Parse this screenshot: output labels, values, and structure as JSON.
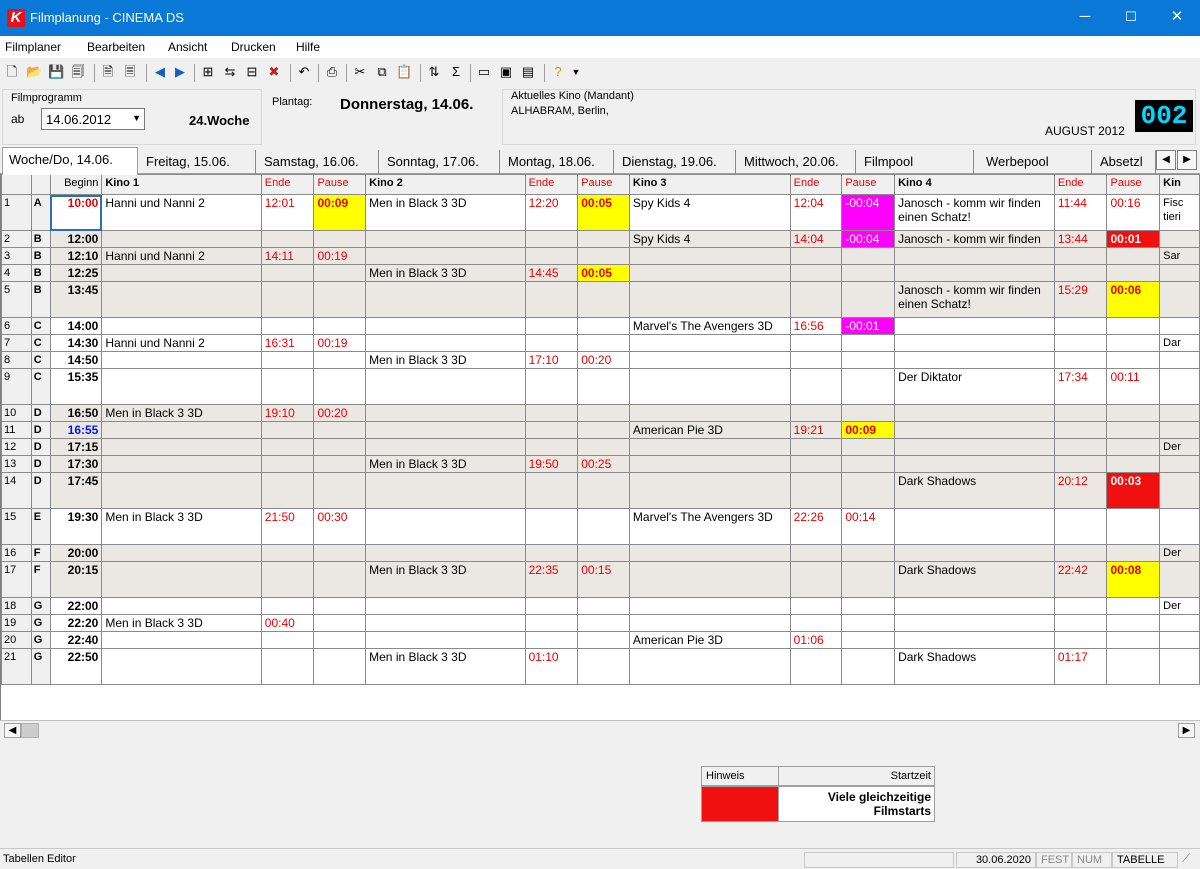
{
  "window": {
    "title": "Filmplanung - CINEMA DS",
    "logo_letter": "K",
    "btn_min": "─",
    "btn_max": "☐",
    "btn_close": "✕"
  },
  "menu": [
    "Filmplaner",
    "Bearbeiten",
    "Ansicht",
    "Drucken",
    "Hilfe"
  ],
  "info": {
    "filmprogramm_label": "Filmprogramm",
    "ab_label": "ab",
    "date_value": "14.06.2012",
    "week": "24.Woche",
    "plantag_label": "Plantag:",
    "plantag_value": "Donnerstag, 14.06.",
    "kino_label": "Aktuelles Kino (Mandant)",
    "kino_value": "ALHABRAM, Berlin,",
    "month": "AUGUST 2012",
    "counter": "002"
  },
  "tabs": [
    "Woche/Do, 14.06.",
    "Freitag, 15.06.",
    "Samstag, 16.06.",
    "Sonntag, 17.06.",
    "Montag, 18.06.",
    "Dienstag, 19.06.",
    "Mittwoch, 20.06.",
    "Filmpool",
    "Werbepool",
    "Absetzl"
  ],
  "headers": [
    "",
    "",
    "Beginn",
    "Kino 1",
    "Ende",
    "Pause",
    "Kino 2",
    "Ende",
    "Pause",
    "Kino 3",
    "Ende",
    "Pause",
    "Kino 4",
    "Ende",
    "Pause",
    "Kin"
  ],
  "rows": [
    {
      "n": "1",
      "g": "A",
      "t": "10:00",
      "c": [
        "Hanni und Nanni 2",
        "12:01",
        "00:09",
        "Men in Black 3 3D",
        "12:20",
        "00:05",
        "Spy Kids 4",
        "12:04",
        "-00:04",
        "Janosch - komm wir finden einen Schatz!",
        "11:44",
        "00:16",
        "Fisc tieri"
      ]
    },
    {
      "n": "2",
      "g": "B",
      "t": "12:00",
      "c": [
        "",
        "",
        "",
        "",
        "",
        "",
        "Spy Kids 4",
        "14:04",
        "-00:04",
        "Janosch - komm wir finden",
        "13:44",
        "00:01",
        ""
      ]
    },
    {
      "n": "3",
      "g": "B",
      "t": "12:10",
      "c": [
        "Hanni und Nanni 2",
        "14:11",
        "00:19",
        "",
        "",
        "",
        "",
        "",
        "",
        "",
        "",
        "",
        "Sar"
      ]
    },
    {
      "n": "4",
      "g": "B",
      "t": "12:25",
      "c": [
        "",
        "",
        "",
        "Men in Black 3 3D",
        "14:45",
        "00:05",
        "",
        "",
        "",
        "",
        "",
        "",
        ""
      ]
    },
    {
      "n": "5",
      "g": "B",
      "t": "13:45",
      "c": [
        "",
        "",
        "",
        "",
        "",
        "",
        "",
        "",
        "",
        "Janosch - komm wir finden einen Schatz!",
        "15:29",
        "00:06",
        ""
      ]
    },
    {
      "n": "6",
      "g": "C",
      "t": "14:00",
      "c": [
        "",
        "",
        "",
        "",
        "",
        "",
        "Marvel's The Avengers 3D",
        "16:56",
        "-00:01",
        "",
        "",
        "",
        ""
      ]
    },
    {
      "n": "7",
      "g": "C",
      "t": "14:30",
      "c": [
        "Hanni und Nanni 2",
        "16:31",
        "00:19",
        "",
        "",
        "",
        "",
        "",
        "",
        "",
        "",
        "",
        "Dar"
      ]
    },
    {
      "n": "8",
      "g": "C",
      "t": "14:50",
      "c": [
        "",
        "",
        "",
        "Men in Black 3 3D",
        "17:10",
        "00:20",
        "",
        "",
        "",
        "",
        "",
        "",
        ""
      ]
    },
    {
      "n": "9",
      "g": "C",
      "t": "15:35",
      "c": [
        "",
        "",
        "",
        "",
        "",
        "",
        "",
        "",
        "",
        "Der Diktator",
        "17:34",
        "00:11",
        ""
      ]
    },
    {
      "n": "10",
      "g": "D",
      "t": "16:50",
      "c": [
        "Men in Black 3 3D",
        "19:10",
        "00:20",
        "",
        "",
        "",
        "",
        "",
        "",
        "",
        "",
        "",
        ""
      ]
    },
    {
      "n": "11",
      "g": "D",
      "t": "16:55",
      "c": [
        "",
        "",
        "",
        "",
        "",
        "",
        "American Pie 3D",
        "19:21",
        "00:09",
        "",
        "",
        "",
        ""
      ]
    },
    {
      "n": "12",
      "g": "D",
      "t": "17:15",
      "c": [
        "",
        "",
        "",
        "",
        "",
        "",
        "",
        "",
        "",
        "",
        "",
        "",
        "Der"
      ]
    },
    {
      "n": "13",
      "g": "D",
      "t": "17:30",
      "c": [
        "",
        "",
        "",
        "Men in Black 3 3D",
        "19:50",
        "00:25",
        "",
        "",
        "",
        "",
        "",
        "",
        ""
      ]
    },
    {
      "n": "14",
      "g": "D",
      "t": "17:45",
      "c": [
        "",
        "",
        "",
        "",
        "",
        "",
        "",
        "",
        "",
        "Dark Shadows",
        "20:12",
        "00:03",
        ""
      ]
    },
    {
      "n": "15",
      "g": "E",
      "t": "19:30",
      "c": [
        "Men in Black 3 3D",
        "21:50",
        "00:30",
        "",
        "",
        "",
        "Marvel's The Avengers 3D",
        "22:26",
        "00:14",
        "",
        "",
        "",
        ""
      ]
    },
    {
      "n": "16",
      "g": "F",
      "t": "20:00",
      "c": [
        "",
        "",
        "",
        "",
        "",
        "",
        "",
        "",
        "",
        "",
        "",
        "",
        "Der"
      ]
    },
    {
      "n": "17",
      "g": "F",
      "t": "20:15",
      "c": [
        "",
        "",
        "",
        "Men in Black 3 3D",
        "22:35",
        "00:15",
        "",
        "",
        "",
        "Dark Shadows",
        "22:42",
        "00:08",
        ""
      ]
    },
    {
      "n": "18",
      "g": "G",
      "t": "22:00",
      "c": [
        "",
        "",
        "",
        "",
        "",
        "",
        "",
        "",
        "",
        "",
        "",
        "",
        "Der"
      ]
    },
    {
      "n": "19",
      "g": "G",
      "t": "22:20",
      "c": [
        "Men in Black 3 3D",
        "00:40",
        "",
        "",
        "",
        "",
        "",
        "",
        "",
        "",
        "",
        "",
        ""
      ]
    },
    {
      "n": "20",
      "g": "G",
      "t": "22:40",
      "c": [
        "",
        "",
        "",
        "",
        "",
        "",
        "American Pie 3D",
        "01:06",
        "",
        "",
        "",
        "",
        ""
      ]
    },
    {
      "n": "21",
      "g": "G",
      "t": "22:50",
      "c": [
        "",
        "",
        "",
        "Men in Black 3 3D",
        "01:10",
        "",
        "",
        "",
        "",
        "Dark Shadows",
        "01:17",
        "",
        ""
      ]
    }
  ],
  "legend": {
    "hinweis": "Hinweis",
    "startzeit": "Startzeit",
    "message": "Viele gleichzeitige Filmstarts",
    "color": "#f01010"
  },
  "status": {
    "left": "Tabellen Editor",
    "date": "30.06.2020",
    "fest": "FEST",
    "num": "NUM",
    "tabelle": "TABELLE"
  },
  "colors": {
    "title_bar": "#0a78d7",
    "pause_ok": "#ffff00",
    "pause_negative": "#ff00ff",
    "pause_conflict": "#f01010"
  }
}
